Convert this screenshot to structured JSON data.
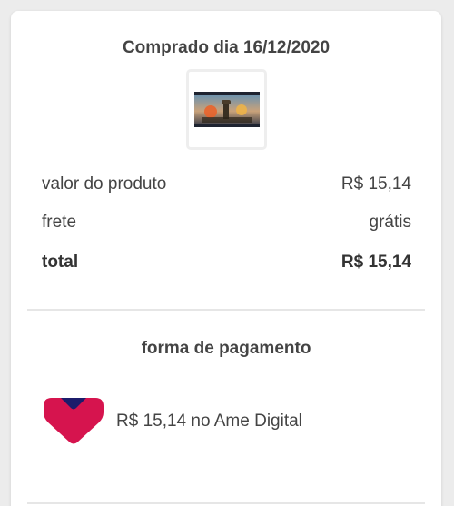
{
  "order": {
    "purchased_label": "Comprado dia 16/12/2020",
    "product_thumbnail": "product-game-poster-image"
  },
  "summary": {
    "rows": [
      {
        "label": "valor do produto",
        "value": "R$ 15,14"
      },
      {
        "label": "frete",
        "value": "grátis"
      },
      {
        "label": "total",
        "value": "R$ 15,14"
      }
    ]
  },
  "payment": {
    "title": "forma de pagamento",
    "icon": "ame-digital-heart-icon",
    "description": "R$ 15,14 no Ame Digital",
    "colors": {
      "ame_pink": "#d6144e",
      "ame_navy": "#1c1c6b"
    }
  }
}
